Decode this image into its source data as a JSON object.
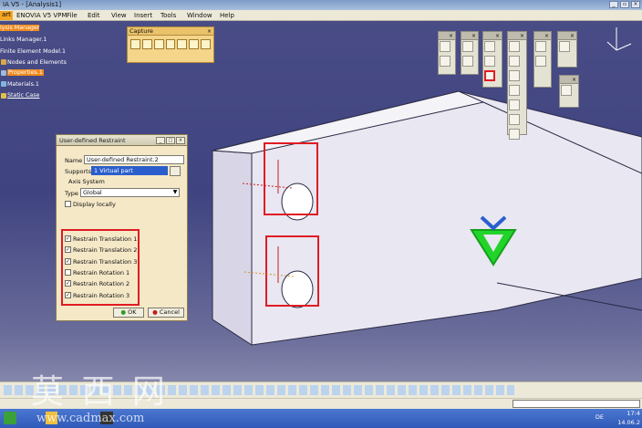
{
  "window": {
    "title": "IA V5 - [Analysis1]"
  },
  "menu": [
    "art",
    "ENOVIA V5 VPM",
    "File",
    "Edit",
    "View",
    "Insert",
    "Tools",
    "Window",
    "Help"
  ],
  "tree": [
    "lysis Manager",
    "Links Manager.1",
    "Finite Element Model.1",
    "Nodes and Elements",
    "Properties.1",
    "Materials.1",
    "Static Case"
  ],
  "toolbars": {
    "capture_title": "Capture"
  },
  "dialog": {
    "title": "User-defined Restraint",
    "name_label": "Name",
    "name_value": "User-defined Restraint.2",
    "supports_label": "Supports",
    "supports_value": "1 Virtual part",
    "axis_group": "Axis System",
    "type_label": "Type",
    "type_value": "Global",
    "display_locally": "Display locally",
    "restraints": [
      {
        "label": "Restrain Translation 1",
        "checked": true
      },
      {
        "label": "Restrain Translation 2",
        "checked": true
      },
      {
        "label": "Restrain Translation 3",
        "checked": true
      },
      {
        "label": "Restrain Rotation 1",
        "checked": false
      },
      {
        "label": "Restrain Rotation 2",
        "checked": true
      },
      {
        "label": "Restrain Rotation 3",
        "checked": true
      }
    ],
    "ok": "OK",
    "cancel": "Cancel"
  },
  "status": {
    "lang": "DE",
    "time": "17:4",
    "date": "14.06.2"
  },
  "watermark": {
    "cn": "莫 西 网",
    "url": "www.cadmax.com"
  },
  "colors": {
    "highlight": "#f08a1c",
    "annotation": "#e01b24",
    "dialog_bg": "#f4e8c7"
  }
}
